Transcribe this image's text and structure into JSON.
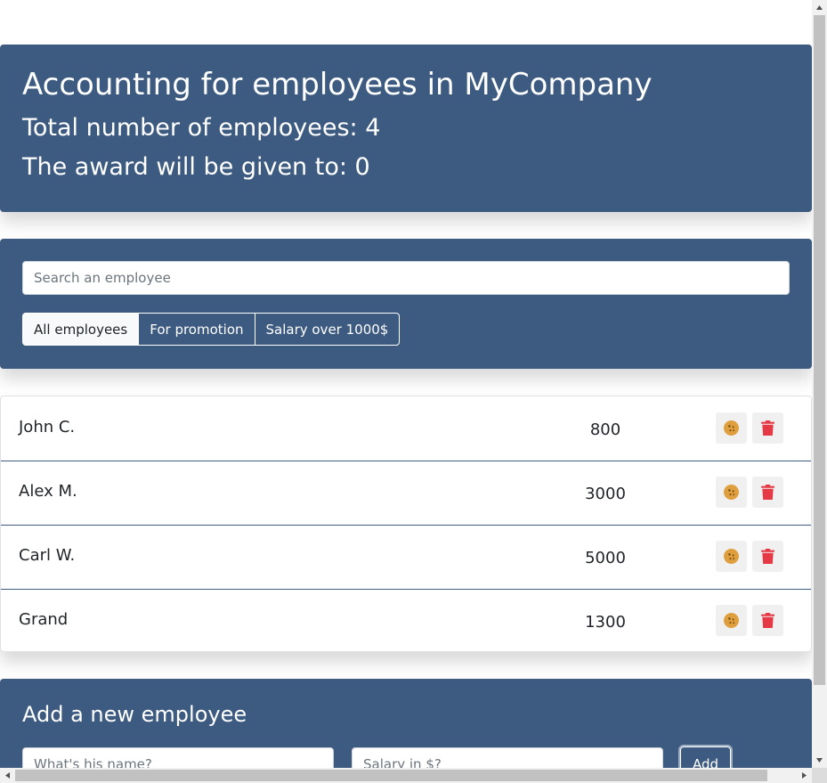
{
  "app_info": {
    "title": "Accounting for employees in MyCompany",
    "total_label": "Total number of employees: 4",
    "award_label": "The award will be given to: 0"
  },
  "search": {
    "placeholder": "Search an employee",
    "value": ""
  },
  "filters": [
    {
      "label": "All employees",
      "active": true
    },
    {
      "label": "For promotion",
      "active": false
    },
    {
      "label": "Salary over 1000$",
      "active": false
    }
  ],
  "employees": [
    {
      "name": "John C.",
      "salary": "800"
    },
    {
      "name": "Alex M.",
      "salary": "3000"
    },
    {
      "name": "Carl W.",
      "salary": "5000"
    },
    {
      "name": "Grand",
      "salary": "1300"
    }
  ],
  "row_icons": {
    "increase": "cookie-icon",
    "delete": "trash-icon"
  },
  "add_form": {
    "title": "Add a new employee",
    "name_placeholder": "What's his name?",
    "salary_placeholder": "Salary in $?",
    "button_label": "Add"
  },
  "colors": {
    "panel_bg": "#3d5a80",
    "cookie_icon": "#e09f3e",
    "trash_icon": "#e63946",
    "active_filter_bg": "#f8f9fa"
  }
}
